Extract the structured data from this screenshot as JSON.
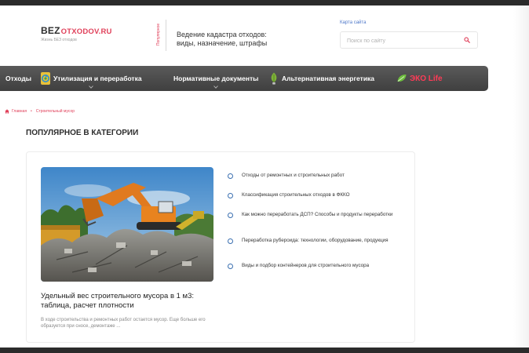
{
  "header": {
    "logo": {
      "bez": "BEZ",
      "domain": "OTXODOV.RU",
      "tagline": "Жизнь БЕЗ отходов"
    },
    "popular_label": "Популярное",
    "featured_article": "Ведение кадастра отходов: виды, назначение, штрафы",
    "sitemap_label": "Карта сайта",
    "search": {
      "placeholder": "Поиск по сайту",
      "value": ""
    }
  },
  "nav": {
    "items": [
      {
        "label": "Отходы",
        "icon": ""
      },
      {
        "label": "Утилизация и переработка",
        "icon": "recycle-icon"
      },
      {
        "label": "Нормативные документы",
        "icon": ""
      },
      {
        "label": "Альтернативная энергетика",
        "icon": "leaf-bulb-icon"
      },
      {
        "label": "ЭКО Life",
        "icon": "eco-leaf-icon"
      }
    ]
  },
  "breadcrumb": {
    "home": "Главная",
    "current": "Строительный мусор"
  },
  "section_title": "ПОПУЛЯРНОЕ В КАТЕГОРИИ",
  "featured": {
    "title": "Удельный вес строительного мусора в 1 м3: таблица, расчет плотности",
    "excerpt": "В ходе строительства и ремонтных работ остается мусор. Еще больше его образуется при сносе, демонтаже ..."
  },
  "related": [
    "Отходы от ремонтных и строительных работ",
    "Классификация строительных отходов в ФККО",
    "Как можно переработать ДСП? Способы и продукты переработки",
    "Переработка рубероида: технологии, оборудование, продукция",
    "Виды и подбор контейнеров для строительного мусора"
  ],
  "colors": {
    "accent": "#e0405a",
    "nav_bg": "#4a4a4a",
    "link": "#3a6fb0"
  }
}
